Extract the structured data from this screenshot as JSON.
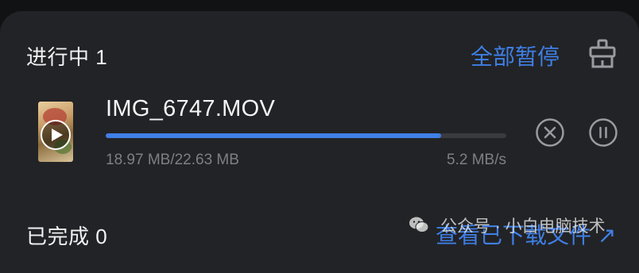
{
  "sections": {
    "active_title": "进行中 1",
    "done_title": "已完成 0"
  },
  "header": {
    "pause_all_label": "全部暂停",
    "clear_icon": "clear-broom-icon"
  },
  "download_item": {
    "file_name": "IMG_6747.MOV",
    "size_progress": "18.97 MB/22.63 MB",
    "speed": "5.2 MB/s",
    "progress_fraction": 0.838,
    "thumbnail_icon": "video-play-icon",
    "cancel_icon": "cancel-circle-icon",
    "pause_icon": "pause-circle-icon"
  },
  "footer": {
    "view_downloaded_label": "查看已下载文件 ↗"
  },
  "watermark": {
    "text": "公众号 · 小白电脑技术",
    "icon": "wechat-icon"
  },
  "colors": {
    "accent": "#3f7fe6",
    "panel_bg": "#222326",
    "text_primary": "#f2f2f4",
    "text_secondary": "#7e7f84"
  }
}
